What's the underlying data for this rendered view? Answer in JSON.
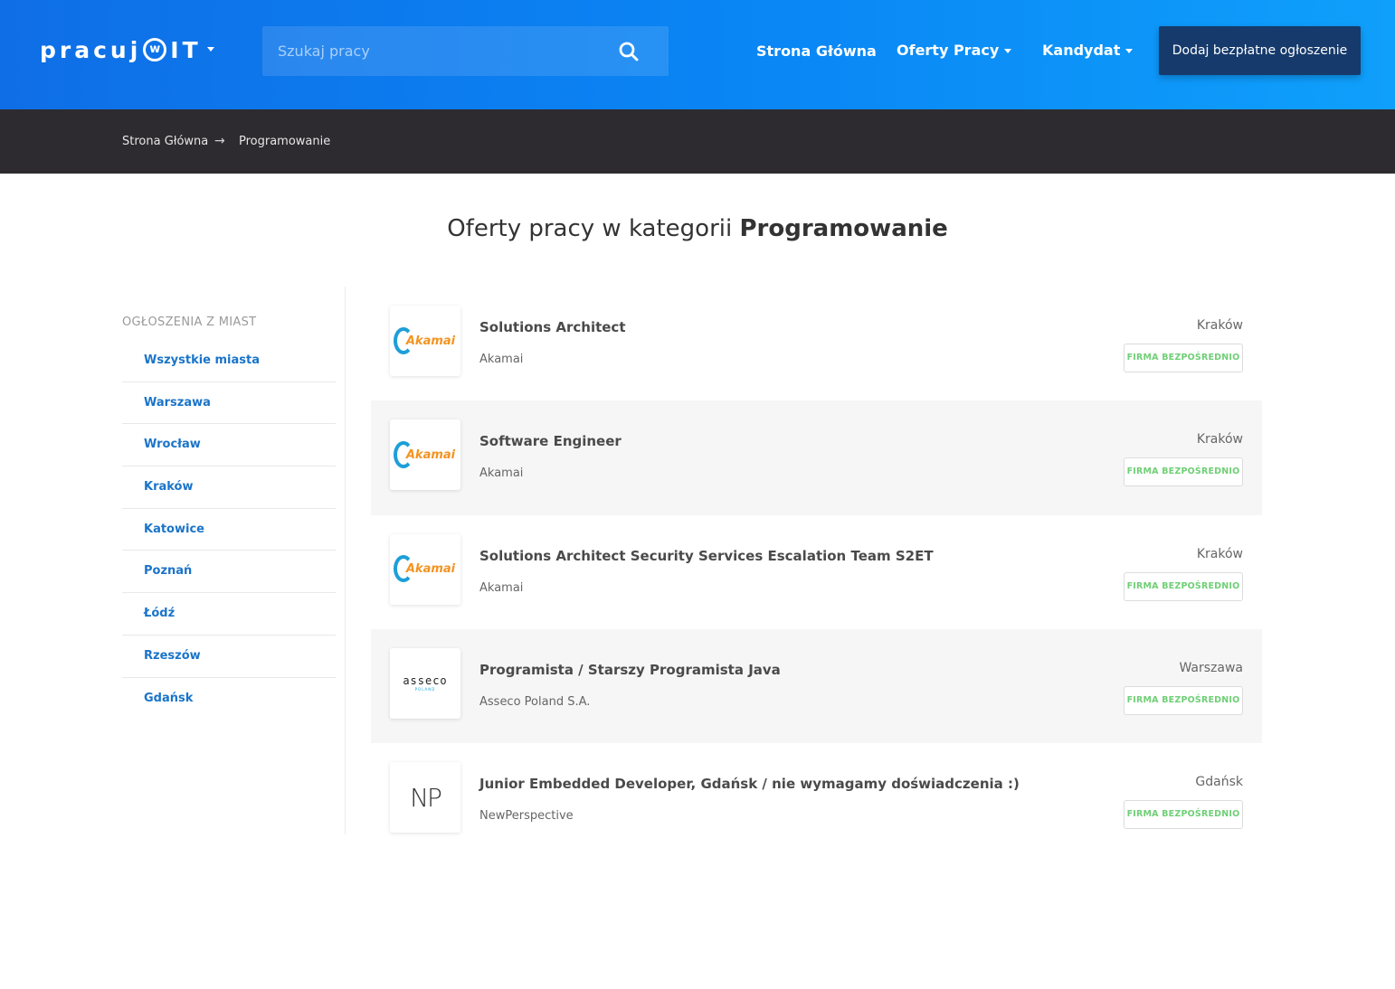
{
  "header": {
    "logo": {
      "text": "pracuj",
      "w": "w",
      "it": "IT"
    },
    "search": {
      "placeholder": "Szukaj pracy"
    },
    "nav": [
      {
        "label": "Strona Główna",
        "dropdown": false
      },
      {
        "label": "Oferty Pracy",
        "dropdown": true
      },
      {
        "label": "Kandydat",
        "dropdown": true
      }
    ],
    "cta_label": "Dodaj bezpłatne ogłoszenie"
  },
  "breadcrumb": {
    "home": "Strona Główna",
    "separator": "→",
    "current": "Programowanie"
  },
  "page_title": {
    "prefix": "Oferty pracy w kategorii",
    "category": "Programowanie"
  },
  "sidebar": {
    "header": "OGŁOSZENIA Z MIAST",
    "cities": [
      "Wszystkie miasta",
      "Warszawa",
      "Wrocław",
      "Kraków",
      "Katowice",
      "Poznań",
      "Łódź",
      "Rzeszów",
      "Gdańsk"
    ]
  },
  "jobs": [
    {
      "title": "Solutions Architect",
      "company": "Akamai",
      "city": "Kraków",
      "badge": "FIRMA BEZPOŚREDNIO",
      "logo": "Akamai"
    },
    {
      "title": "Software Engineer",
      "company": "Akamai",
      "city": "Kraków",
      "badge": "FIRMA BEZPOŚREDNIO",
      "logo": "Akamai"
    },
    {
      "title": "Solutions Architect Security Services Escalation Team S2ET",
      "company": "Akamai",
      "city": "Kraków",
      "badge": "FIRMA BEZPOŚREDNIO",
      "logo": "Akamai"
    },
    {
      "title": "Programista / Starszy Programista Java",
      "company": "Asseco Poland S.A.",
      "city": "Warszawa",
      "badge": "FIRMA BEZPOŚREDNIO",
      "logo": "asseco",
      "logo_sub": "POLAND"
    },
    {
      "title": "Junior Embedded Developer, Gdańsk / nie wymagamy doświadczenia :)",
      "company": "NewPerspective",
      "city": "Gdańsk",
      "badge": "FIRMA BEZPOŚREDNIO",
      "logo": "NP"
    }
  ],
  "colors": {
    "header_start": "#0f6ee6",
    "header_end": "#0fa0fb",
    "cta_bg": "#163a6b",
    "breadcrumb_bg": "#2d2b30",
    "city_link": "#1a74c9",
    "badge_text": "#6fcf76"
  }
}
